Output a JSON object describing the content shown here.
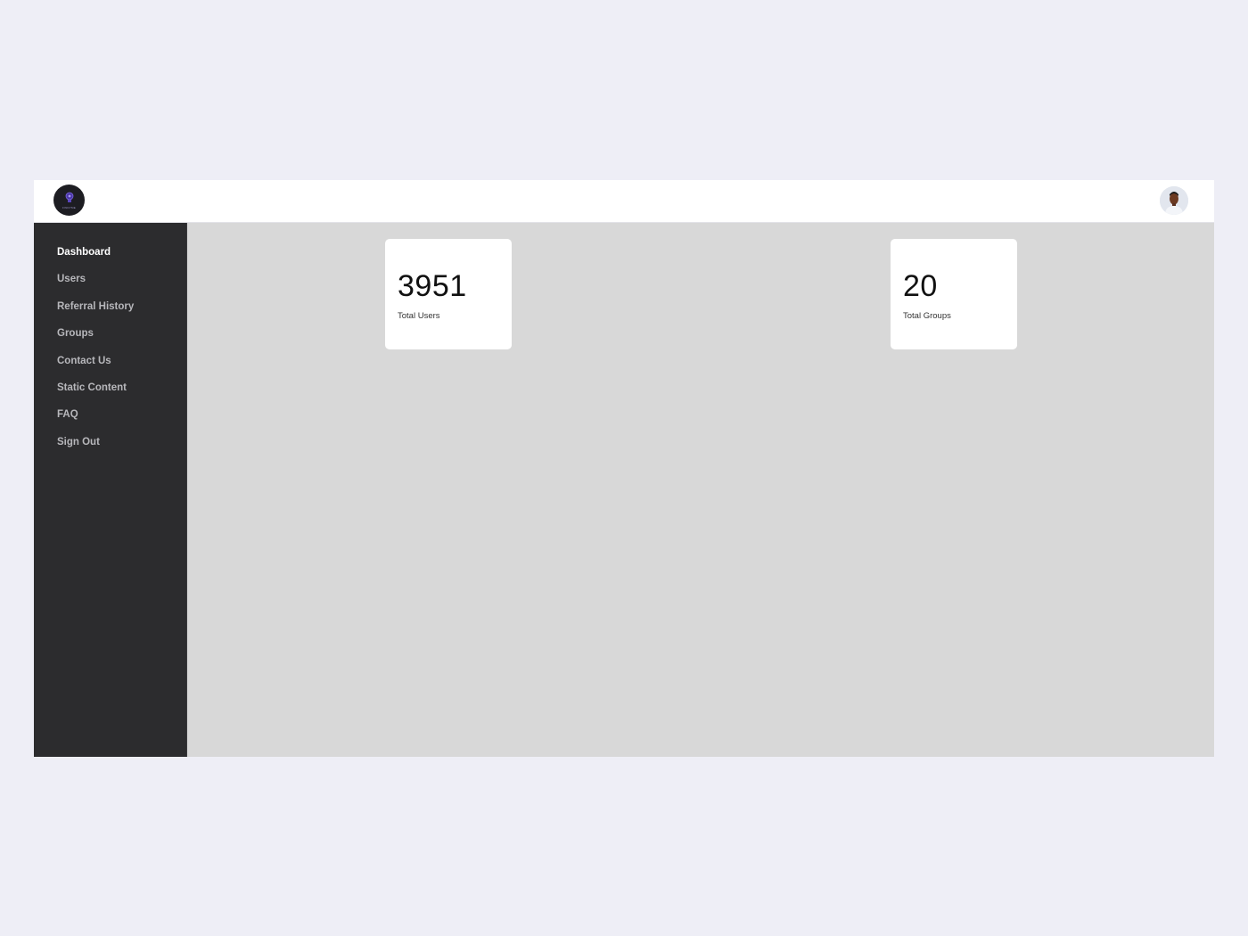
{
  "header": {
    "logo_icon": "lightbulb-logo-icon",
    "logo_text": "FINDYME",
    "avatar_icon": "user-avatar-photo"
  },
  "sidebar": {
    "items": [
      {
        "label": "Dashboard",
        "active": true
      },
      {
        "label": "Users",
        "active": false
      },
      {
        "label": "Referral History",
        "active": false
      },
      {
        "label": "Groups",
        "active": false
      },
      {
        "label": "Contact Us",
        "active": false
      },
      {
        "label": "Static Content",
        "active": false
      },
      {
        "label": "FAQ",
        "active": false
      },
      {
        "label": "Sign Out",
        "active": false
      }
    ]
  },
  "stats": {
    "users": {
      "value": "3951",
      "label": "Total Users"
    },
    "groups": {
      "value": "20",
      "label": "Total Groups"
    }
  },
  "colors": {
    "page_bg": "#eeeef6",
    "sidebar_bg": "#2c2c2e",
    "main_bg": "#d8d8d8",
    "accent": "#6b4fd8"
  }
}
